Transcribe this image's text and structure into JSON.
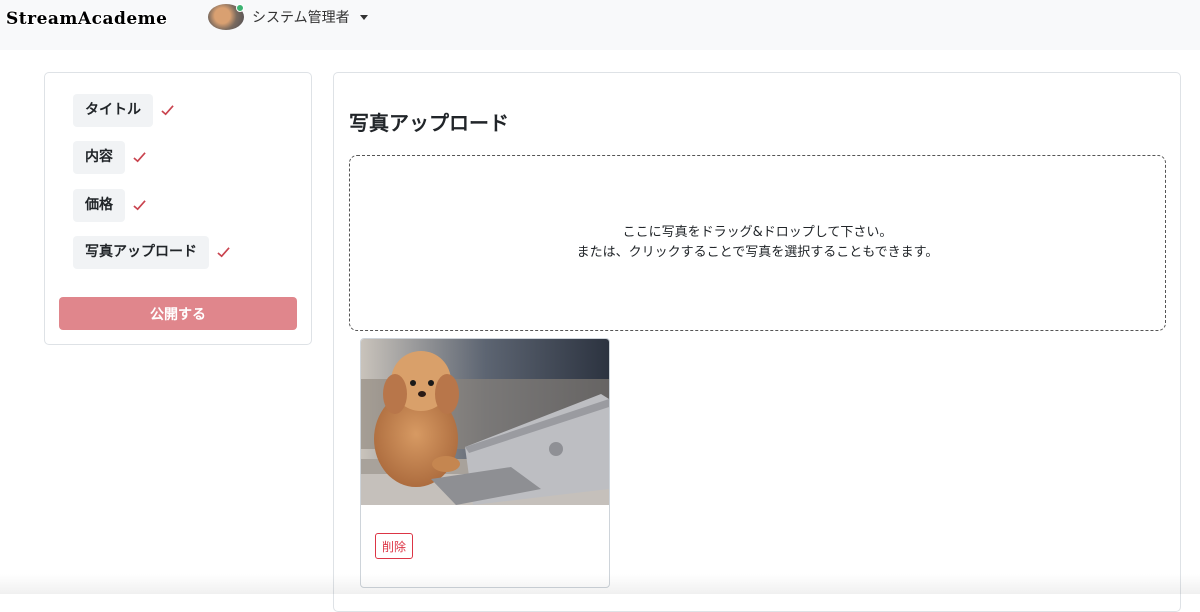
{
  "header": {
    "brand": "StreamAcademe",
    "user_name": "システム管理者",
    "avatar_icon": "user-avatar-photo",
    "status_color": "#3cb371"
  },
  "sidebar": {
    "steps": [
      {
        "label": "タイトル",
        "done": true
      },
      {
        "label": "内容",
        "done": true
      },
      {
        "label": "価格",
        "done": true
      },
      {
        "label": "写真アップロード",
        "done": true
      }
    ],
    "check_icon": "check-icon",
    "check_color": "#c9434e",
    "publish_label": "公開する",
    "publish_color": "#e0868c"
  },
  "main": {
    "title": "写真アップロード",
    "dropzone": {
      "line1": "ここに写真をドラッグ&ドロップして下さい。",
      "line2": "または、クリックすることで写真を選択することもできます。"
    },
    "photos": [
      {
        "subject": "poodle-with-laptop",
        "delete_label": "削除"
      }
    ],
    "delete_color": "#dc3545"
  }
}
